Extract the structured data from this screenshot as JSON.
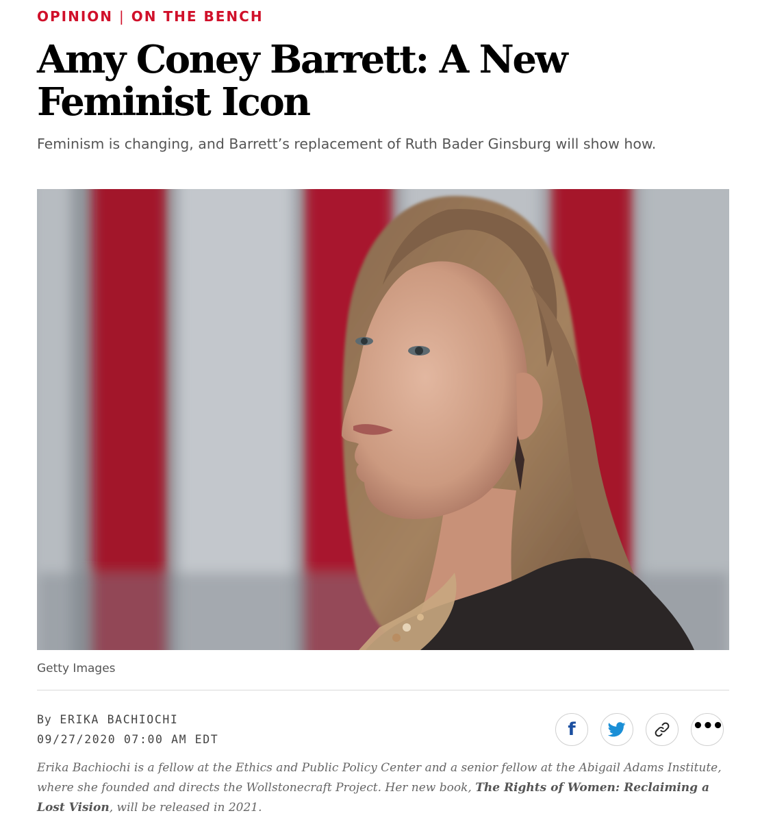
{
  "kicker": {
    "section": "OPINION",
    "separator": "|",
    "column": "ON THE BENCH"
  },
  "headline": "Amy Coney Barrett: A New Feminist Icon",
  "dek": "Feminism is changing, and Barrett’s replacement of Ruth Bader Ginsburg will show how.",
  "photo": {
    "credit": "Getty Images"
  },
  "byline": {
    "prefix": "By",
    "author": "ERIKA BACHIOCHI",
    "datetime": "09/27/2020 07:00 AM EDT"
  },
  "share": {
    "icons": [
      "facebook-icon",
      "twitter-icon",
      "link-icon",
      "more-icon"
    ],
    "facebook_glyph": "f",
    "more_glyph": "•••"
  },
  "bio": {
    "part1": "Erika Bachiochi is a fellow at the Ethics and Public Policy Center and a senior fellow at the Abigail Adams Institute, where she founded and directs the Wollstonecraft Project. Her new book, ",
    "book_title": "The Rights of Women: Reclaiming a Lost Vision",
    "part2": ", will be released in 2021."
  },
  "colors": {
    "accent": "#d0102a",
    "headline": "#000000",
    "muted": "#555555"
  }
}
